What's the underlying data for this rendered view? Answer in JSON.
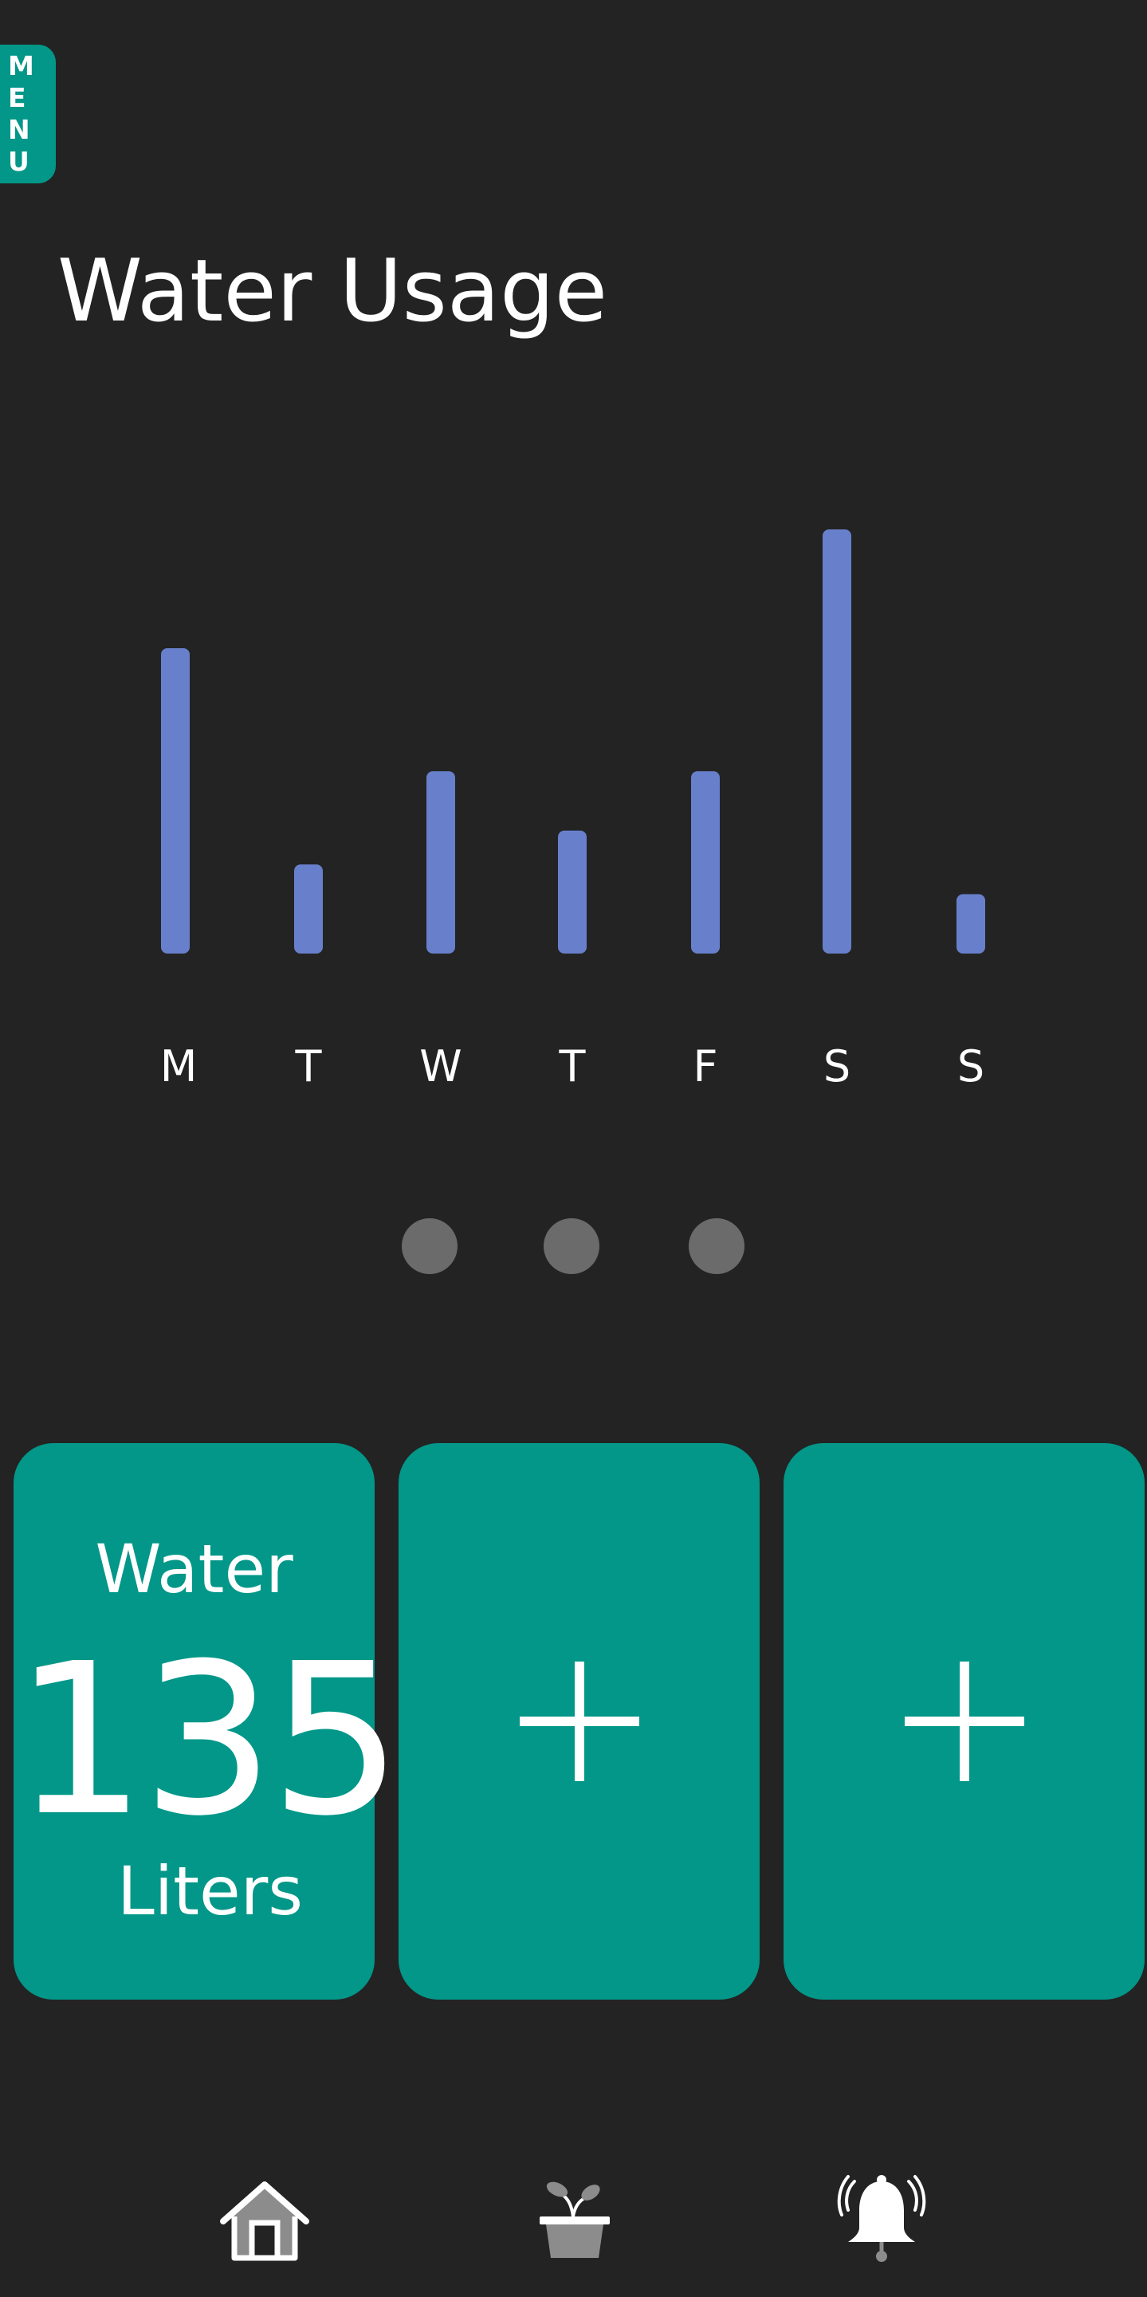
{
  "menu": {
    "letters": [
      "M",
      "E",
      "N",
      "U"
    ]
  },
  "page": {
    "title": "Water Usage"
  },
  "chart_data": {
    "type": "bar",
    "categories": [
      "M",
      "T",
      "W",
      "T",
      "F",
      "S",
      "S"
    ],
    "values": [
      72,
      21,
      43,
      29,
      43,
      100,
      14
    ],
    "ylim": [
      0,
      100
    ],
    "title": "",
    "xlabel": "",
    "ylabel": "",
    "grid": false,
    "bar_color": "#6880cb"
  },
  "pager": {
    "count": 3
  },
  "cards": {
    "water_label": "Water",
    "water_value": "135",
    "water_unit": "Liters"
  },
  "nav": {
    "items": [
      "home-icon",
      "plant-icon",
      "alarm-bell-icon"
    ]
  },
  "colors": {
    "background": "#232323",
    "accent": "#029788",
    "bar": "#6880cb",
    "dot": "#6b6b6b",
    "text": "#ffffff"
  }
}
